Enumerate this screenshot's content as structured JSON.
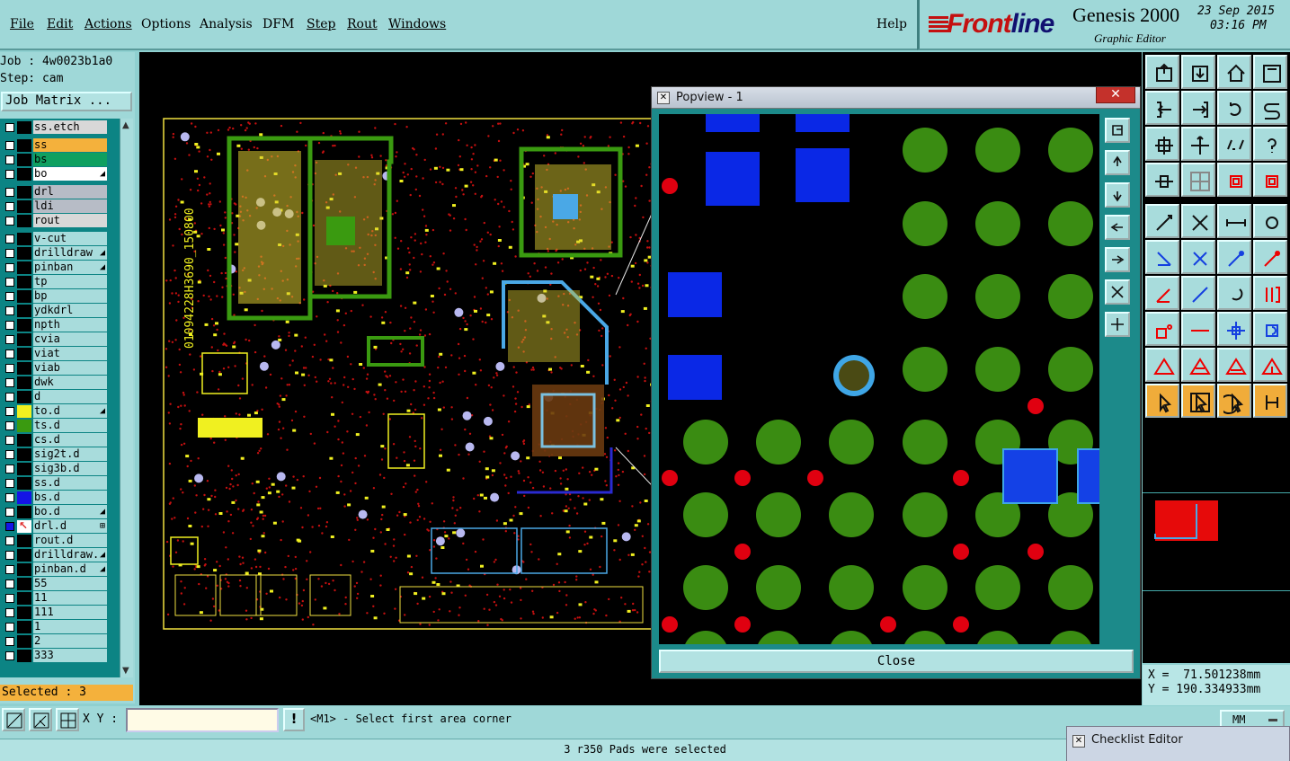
{
  "menu": {
    "items": [
      {
        "label": "File",
        "underlined": true
      },
      {
        "label": "Edit",
        "underlined": true
      },
      {
        "label": "Actions",
        "underlined": true
      },
      {
        "label": "Options",
        "underlined": false
      },
      {
        "label": "Analysis",
        "underlined": false
      },
      {
        "label": "DFM",
        "underlined": false
      },
      {
        "label": "Step",
        "underlined": true
      },
      {
        "label": "Rout",
        "underlined": true
      },
      {
        "label": "Windows",
        "underlined": true
      }
    ],
    "help": "Help"
  },
  "brand": {
    "logo_part1": "Front",
    "logo_part2": "line",
    "product": "Genesis 2000",
    "subtitle": "Graphic Editor",
    "date": "23 Sep 2015",
    "time": "03:16 PM"
  },
  "job": {
    "job_line": "Job : 4w0023b1a0",
    "step_line": "Step: cam",
    "matrix_button": "Job Matrix ..."
  },
  "layers": [
    {
      "name": "ss.etch",
      "color": "#000000",
      "highlight": "#d8d8d8",
      "mark": "",
      "group": 0
    },
    {
      "name": "ss",
      "color": "#000000",
      "highlight": "#f4b13c",
      "mark": "",
      "group": 1
    },
    {
      "name": "bs",
      "color": "#000000",
      "highlight": "#0fa060",
      "mark": "",
      "group": 1
    },
    {
      "name": "bo",
      "color": "#000000",
      "highlight": "#ffffff",
      "mark": "◢",
      "group": 1
    },
    {
      "name": "drl",
      "color": "#000000",
      "highlight": "#b7bcc6",
      "mark": "",
      "group": 2
    },
    {
      "name": "ldi",
      "color": "#000000",
      "highlight": "#b7bcc6",
      "mark": "",
      "group": 2
    },
    {
      "name": "rout",
      "color": "#000000",
      "highlight": "#d8d8d8",
      "mark": "",
      "group": 2
    },
    {
      "name": "v-cut",
      "color": "#000000",
      "highlight": "#a8dcdc",
      "mark": "",
      "group": 3
    },
    {
      "name": "drilldraw",
      "color": "#000000",
      "highlight": "#a8dcdc",
      "mark": "◢",
      "group": 3
    },
    {
      "name": "pinban",
      "color": "#000000",
      "highlight": "#a8dcdc",
      "mark": "◢",
      "group": 3
    },
    {
      "name": "tp",
      "color": "#000000",
      "highlight": "#a8dcdc",
      "mark": "",
      "group": 3
    },
    {
      "name": "bp",
      "color": "#000000",
      "highlight": "#a8dcdc",
      "mark": "",
      "group": 3
    },
    {
      "name": "ydkdrl",
      "color": "#000000",
      "highlight": "#a8dcdc",
      "mark": "",
      "group": 3
    },
    {
      "name": "npth",
      "color": "#000000",
      "highlight": "#a8dcdc",
      "mark": "",
      "group": 3
    },
    {
      "name": "cvia",
      "color": "#000000",
      "highlight": "#a8dcdc",
      "mark": "",
      "group": 3
    },
    {
      "name": "viat",
      "color": "#000000",
      "highlight": "#a8dcdc",
      "mark": "",
      "group": 3
    },
    {
      "name": "viab",
      "color": "#000000",
      "highlight": "#a8dcdc",
      "mark": "",
      "group": 3
    },
    {
      "name": "dwk",
      "color": "#000000",
      "highlight": "#a8dcdc",
      "mark": "",
      "group": 3
    },
    {
      "name": "d",
      "color": "#000000",
      "highlight": "#a8dcdc",
      "mark": "",
      "group": 3
    },
    {
      "name": "to.d",
      "color": "#f0f020",
      "highlight": "#a8dcdc",
      "mark": "◢",
      "group": 3
    },
    {
      "name": "ts.d",
      "color": "#3a9a10",
      "highlight": "#a8dcdc",
      "mark": "",
      "group": 3
    },
    {
      "name": "cs.d",
      "color": "#000000",
      "highlight": "#a8dcdc",
      "mark": "",
      "group": 3
    },
    {
      "name": "sig2t.d",
      "color": "#000000",
      "highlight": "#a8dcdc",
      "mark": "",
      "group": 3
    },
    {
      "name": "sig3b.d",
      "color": "#000000",
      "highlight": "#a8dcdc",
      "mark": "",
      "group": 3
    },
    {
      "name": "ss.d",
      "color": "#000000",
      "highlight": "#a8dcdc",
      "mark": "",
      "group": 3
    },
    {
      "name": "bs.d",
      "color": "#1414e6",
      "highlight": "#a8dcdc",
      "mark": "",
      "group": 3
    },
    {
      "name": "bo.d",
      "color": "#000000",
      "highlight": "#a8dcdc",
      "mark": "◢",
      "group": 3
    },
    {
      "name": "drl.d",
      "color": "#e03030",
      "highlight": "#a8dcdc",
      "mark": "⊞",
      "group": 3
    },
    {
      "name": "rout.d",
      "color": "#000000",
      "highlight": "#a8dcdc",
      "mark": "",
      "group": 3
    },
    {
      "name": "drilldraw.",
      "color": "#000000",
      "highlight": "#a8dcdc",
      "mark": "◢",
      "group": 3
    },
    {
      "name": "pinban.d",
      "color": "#000000",
      "highlight": "#a8dcdc",
      "mark": "◢",
      "group": 3
    },
    {
      "name": "55",
      "color": "#000000",
      "highlight": "#a8dcdc",
      "mark": "",
      "group": 3
    },
    {
      "name": "11",
      "color": "#000000",
      "highlight": "#a8dcdc",
      "mark": "",
      "group": 3
    },
    {
      "name": "111",
      "color": "#000000",
      "highlight": "#a8dcdc",
      "mark": "",
      "group": 3
    },
    {
      "name": "1",
      "color": "#000000",
      "highlight": "#a8dcdc",
      "mark": "",
      "group": 3
    },
    {
      "name": "2",
      "color": "#000000",
      "highlight": "#a8dcdc",
      "mark": "",
      "group": 3
    },
    {
      "name": "333",
      "color": "#000000",
      "highlight": "#a8dcdc",
      "mark": "",
      "group": 3
    }
  ],
  "selected_count": "Selected : 3",
  "board": {
    "silkscreen_text": "01094228H3690_150800"
  },
  "popview": {
    "title": "Popview - 1",
    "close_label": "Close"
  },
  "coords": {
    "x_line": "X =  71.501238mm",
    "y_line": "Y = 190.334933mm"
  },
  "bottom": {
    "xy_label": "X Y :",
    "xy_value": "",
    "excl_label": "!",
    "prompt": "<M1> - Select first area corner",
    "units": "MM",
    "status": "3 r350 Pads were selected"
  },
  "checklist": {
    "title": "Checklist Editor"
  },
  "colors": {
    "bg_teal": "#9fd8d8",
    "pad_green": "#3a8c12",
    "pad_red": "#e00010",
    "pad_blue": "#0a28e6",
    "pad_highlight": "#3fa6e6",
    "silk_yellow": "#f0f020",
    "layer_list_bg": "#0c8484",
    "selected_bg": "#f4b13c"
  },
  "icons": [
    "popview-zoom-icon",
    "popview-up-icon",
    "popview-down-icon",
    "popview-left-icon",
    "popview-right-icon",
    "popview-fit-icon",
    "popview-pan-icon"
  ]
}
